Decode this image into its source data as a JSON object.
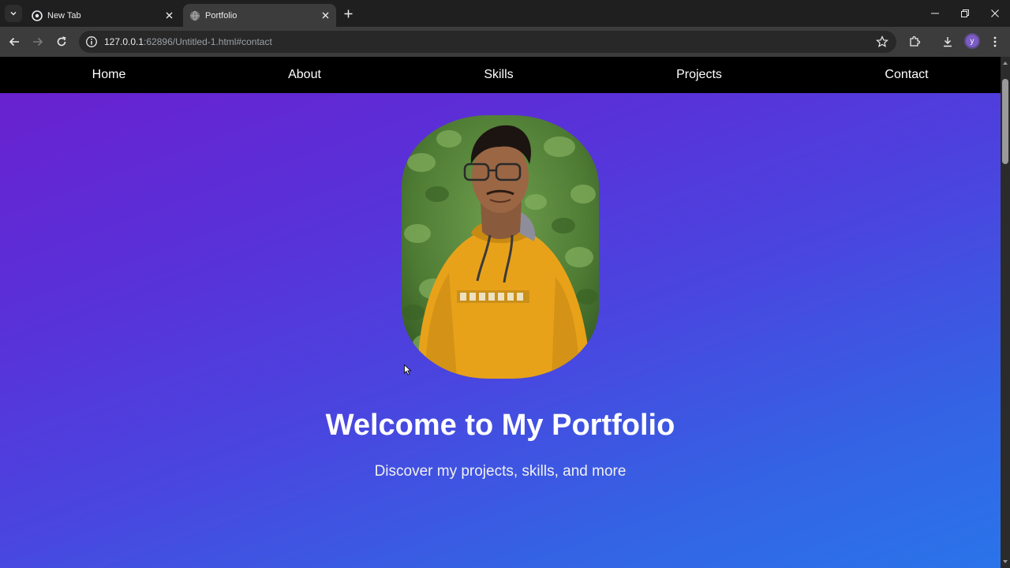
{
  "browser": {
    "tabs": [
      {
        "title": "New Tab",
        "active": false,
        "icon": "chrome-icon"
      },
      {
        "title": "Portfolio",
        "active": true,
        "icon": "globe-icon"
      }
    ],
    "url": {
      "host": "127.0.0.1",
      "rest": ":62896/Untitled-1.html#contact"
    },
    "profile_initial": "y"
  },
  "site": {
    "nav": [
      "Home",
      "About",
      "Skills",
      "Projects",
      "Contact"
    ],
    "hero": {
      "title": "Welcome to My Portfolio",
      "subtitle": "Discover my projects, skills, and more"
    }
  },
  "colors": {
    "gradient_start": "#6b1fce",
    "gradient_end": "#2a74ea",
    "nav_bg": "#000000",
    "shirt": "#e8a21a"
  }
}
